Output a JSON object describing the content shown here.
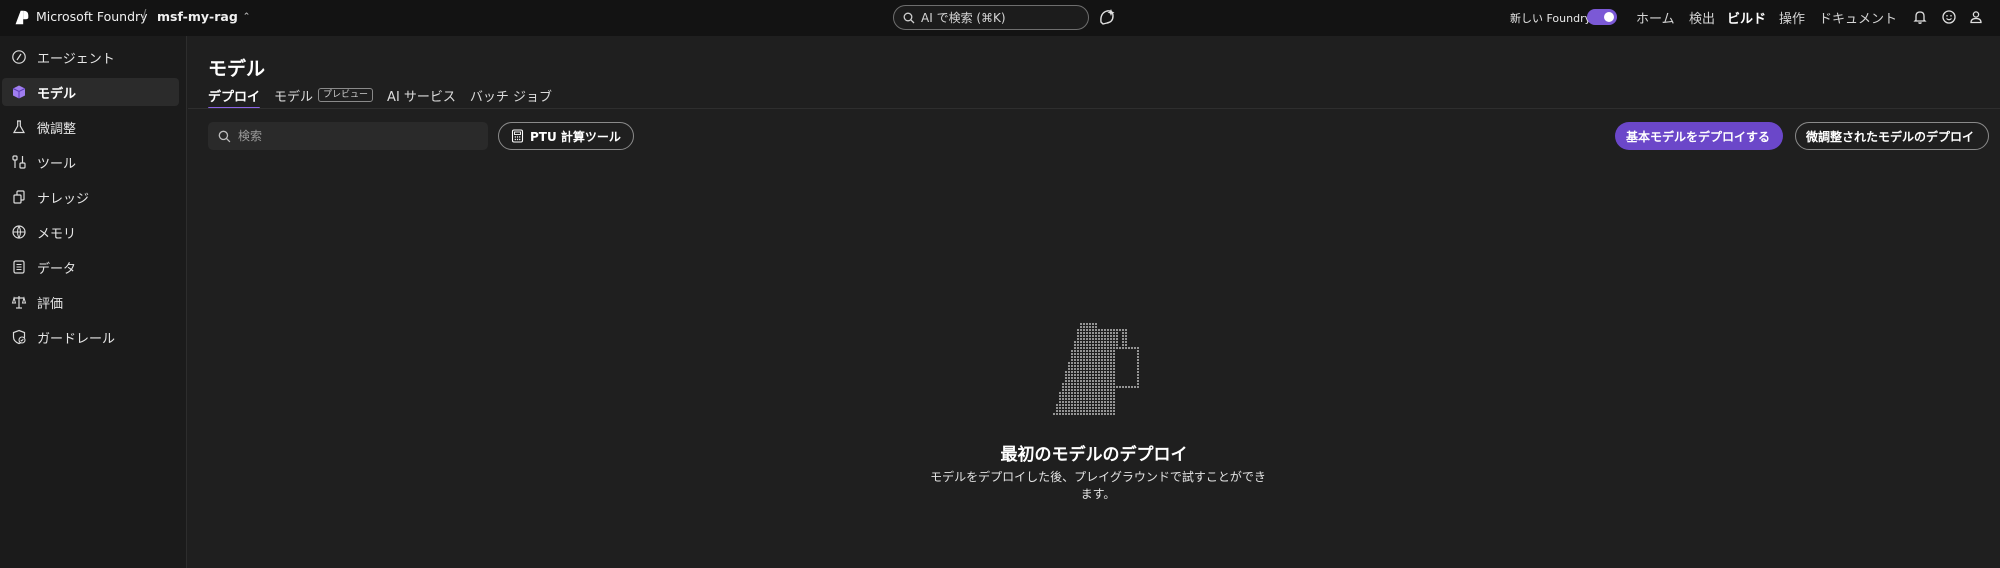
{
  "topbar": {
    "brand": "Microsoft Foundry",
    "separator": "/",
    "project": "msf-my-rag",
    "search_placeholder": "AI で検索 (⌘K)",
    "new_foundry_label": "新しい Foundry",
    "new_foundry_enabled": true,
    "nav": [
      {
        "label": "ホーム",
        "active": false
      },
      {
        "label": "検出",
        "active": false
      },
      {
        "label": "ビルド",
        "active": true
      },
      {
        "label": "操作",
        "active": false
      },
      {
        "label": "ドキュメント",
        "active": false
      }
    ],
    "icons": [
      "bell-icon",
      "feedback-smiley-icon",
      "account-icon"
    ]
  },
  "sidebar": {
    "items": [
      {
        "label": "エージェント",
        "icon": "agent-icon",
        "active": false
      },
      {
        "label": "モデル",
        "icon": "model-cube-icon",
        "active": true
      },
      {
        "label": "微調整",
        "icon": "flask-icon",
        "active": false
      },
      {
        "label": "ツール",
        "icon": "tools-icon",
        "active": false
      },
      {
        "label": "ナレッジ",
        "icon": "knowledge-icon",
        "active": false
      },
      {
        "label": "メモリ",
        "icon": "memory-icon",
        "active": false
      },
      {
        "label": "データ",
        "icon": "data-icon",
        "active": false
      },
      {
        "label": "評価",
        "icon": "scale-icon",
        "active": false
      },
      {
        "label": "ガードレール",
        "icon": "shield-icon",
        "active": false
      }
    ]
  },
  "main": {
    "title": "モデル",
    "tabs": [
      {
        "label": "デプロイ",
        "active": true
      },
      {
        "label": "モデル",
        "badge": "プレビュー",
        "active": false
      },
      {
        "label": "AI サービス",
        "active": false
      },
      {
        "label": "バッチ ジョブ",
        "active": false
      }
    ],
    "search_placeholder": "検索",
    "ptu_button": "PTU 計算ツール",
    "deploy_base_button": "基本モデルをデプロイする",
    "deploy_finetuned_button": "微調整されたモデルのデプロイ",
    "accent_color": "#6b47c9",
    "empty_state": {
      "title": "最初のモデルのデプロイ",
      "description": "モデルをデプロイした後、プレイグラウンドで試すことができます。"
    }
  }
}
